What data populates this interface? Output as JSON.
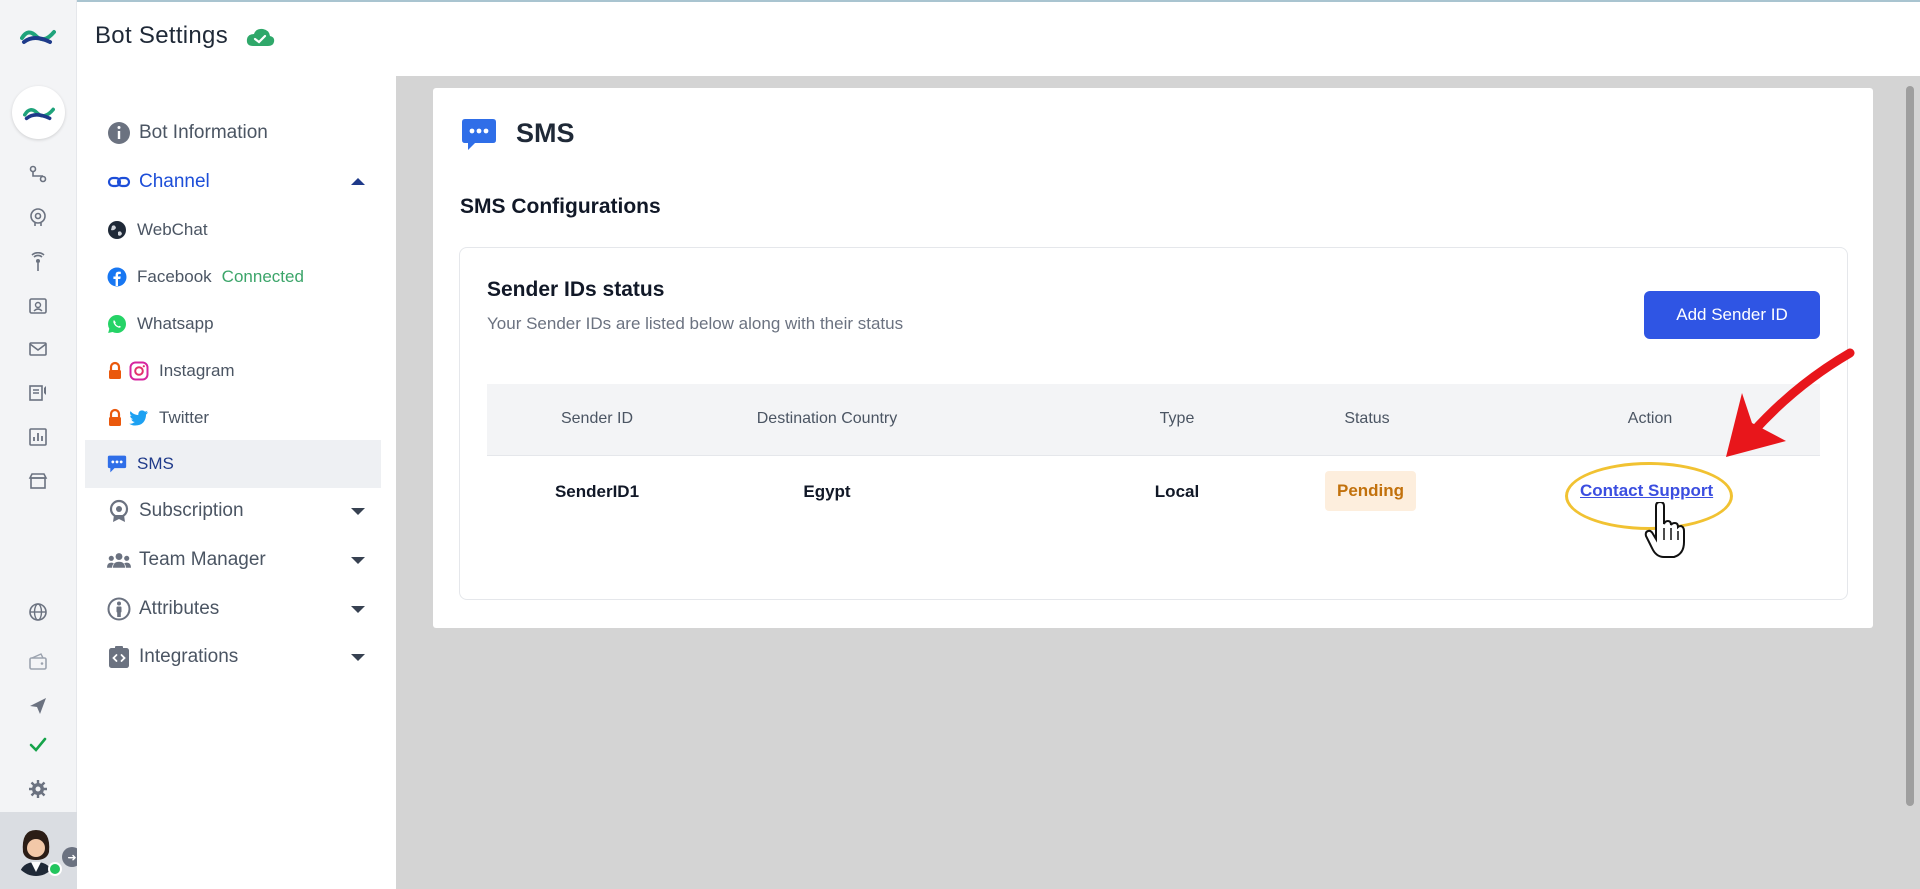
{
  "header": {
    "title": "Bot Settings",
    "status_icon": "cloud-check-icon"
  },
  "rail": {
    "icons": [
      "flow-icon",
      "brain-icon",
      "broadcast-icon",
      "contacts-icon",
      "mail-icon",
      "campaign-icon",
      "analytics-icon",
      "store-icon",
      "globe-icon",
      "wallet-icon",
      "send-icon",
      "check-icon",
      "gear-icon"
    ]
  },
  "nav": {
    "bot_information": "Bot Information",
    "channel": "Channel",
    "webchat": "WebChat",
    "facebook": "Facebook",
    "facebook_status": "Connected",
    "whatsapp": "Whatsapp",
    "instagram": "Instagram",
    "twitter": "Twitter",
    "sms": "SMS",
    "subscription": "Subscription",
    "team_manager": "Team Manager",
    "attributes": "Attributes",
    "integrations": "Integrations"
  },
  "main": {
    "title": "SMS",
    "section_title": "SMS Configurations",
    "card_title": "Sender IDs status",
    "card_subtitle": "Your Sender IDs are listed below along with their status",
    "add_button": "Add Sender ID",
    "table": {
      "columns": [
        "Sender ID",
        "Destination Country",
        "Type",
        "Status",
        "Action"
      ],
      "rows": [
        {
          "sender_id": "SenderID1",
          "country": "Egypt",
          "type": "Local",
          "status": "Pending",
          "action": "Contact Support"
        }
      ]
    }
  },
  "colors": {
    "accent": "#2f55e4",
    "pending_bg": "#fdeedd",
    "pending_text": "#c2710c",
    "connected": "#3ca56a",
    "annotation": "#e8161b"
  }
}
